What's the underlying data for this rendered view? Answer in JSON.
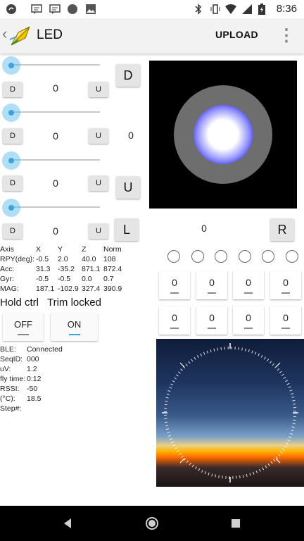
{
  "status_bar": {
    "time": "8:36"
  },
  "app_bar": {
    "back_glyph": "‹",
    "title": "LED",
    "upload_label": "UPLOAD",
    "menu_glyph": "⋮"
  },
  "sliders": [
    {
      "position": 0,
      "down_label": "D",
      "up_label": "U",
      "value": "0"
    },
    {
      "position": 0,
      "down_label": "D",
      "up_label": "U",
      "value": "0"
    },
    {
      "position": 0,
      "down_label": "D",
      "up_label": "U",
      "value": "0"
    },
    {
      "position": 0,
      "down_label": "D",
      "up_label": "U",
      "value": "0"
    }
  ],
  "side_buttons": {
    "d": "D",
    "u": "U",
    "l": "L",
    "r": "R"
  },
  "side_value": "0",
  "center_value": "0",
  "imu": {
    "headers": [
      "Axis",
      "X",
      "Y",
      "Z",
      "Norm"
    ],
    "rows": [
      [
        "RPY(deg):",
        "-0.5",
        "2.0",
        "40.0",
        "108"
      ],
      [
        "Acc:",
        "31.3",
        "-35.2",
        "871.1",
        "872.4"
      ],
      [
        "Gyr:",
        "-0.5",
        "-0.5",
        "0.0",
        "0.7"
      ],
      [
        "MAG:",
        "187.1",
        "-102.9",
        "327.4",
        "390.9"
      ]
    ]
  },
  "hold_ctrl_label": "Hold ctrl",
  "trim_locked_label": "Trim locked",
  "toggle": {
    "off_label": "OFF",
    "on_label": "ON",
    "selected": "ON"
  },
  "info": [
    {
      "label": "BLE:",
      "value": "Connected"
    },
    {
      "label": "SeqID:",
      "value": "000"
    },
    {
      "label": "uV:",
      "value": "1.2"
    },
    {
      "label": "fly time:",
      "value": "0:12"
    },
    {
      "label": "RSSI:",
      "value": "-50"
    },
    {
      "label": "(°C):",
      "value": "18.5"
    },
    {
      "label": "Step#:",
      "value": ""
    }
  ],
  "channels_row1": [
    "0",
    "0",
    "0",
    "0"
  ],
  "channels_row2": [
    "0",
    "0",
    "0",
    "0"
  ],
  "radio_count": 6,
  "colors": {
    "accent": "#3aa3e0",
    "led_core": "#ffffff",
    "led_ring": "#1a1aff",
    "led_halo": "#6e6e6e",
    "led_bg": "#000000"
  }
}
